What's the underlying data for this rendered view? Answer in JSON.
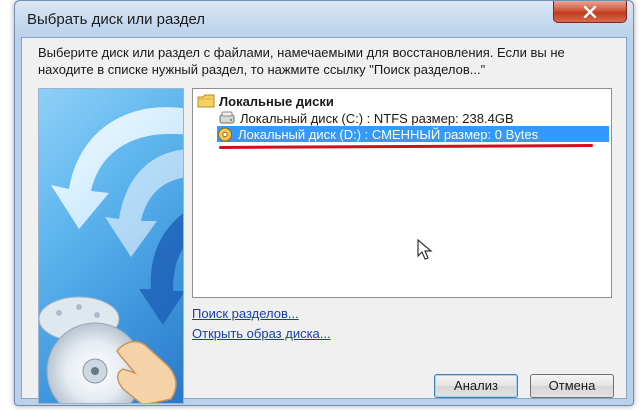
{
  "window": {
    "title": "Выбрать диск или раздел"
  },
  "description": "Выберите диск или раздел с файлами, намечаемыми для восстановления. Если вы не находите в списке нужный раздел, то нажмите ссылку \"Поиск разделов...\"",
  "tree": {
    "root_label": "Локальные диски",
    "root_icon": "folder-icon",
    "items": [
      {
        "label": "Локальный диск (C:) : NTFS размер: 238.4GB",
        "icon": "hard-drive-icon",
        "selected": false
      },
      {
        "label": "Локальный диск (D:) : СМЕННЫЙ размер: 0 Bytes",
        "icon": "removable-disk-icon",
        "selected": true
      }
    ]
  },
  "links": {
    "search_partitions": "Поиск разделов...",
    "open_disk_image": "Открыть образ диска..."
  },
  "buttons": {
    "analyze": "Анализ",
    "cancel": "Отмена"
  },
  "colors": {
    "selection": "#3399ff",
    "highlight_underline": "#d0101a",
    "link": "#1a3fa8",
    "close_button": "#c9452a"
  }
}
